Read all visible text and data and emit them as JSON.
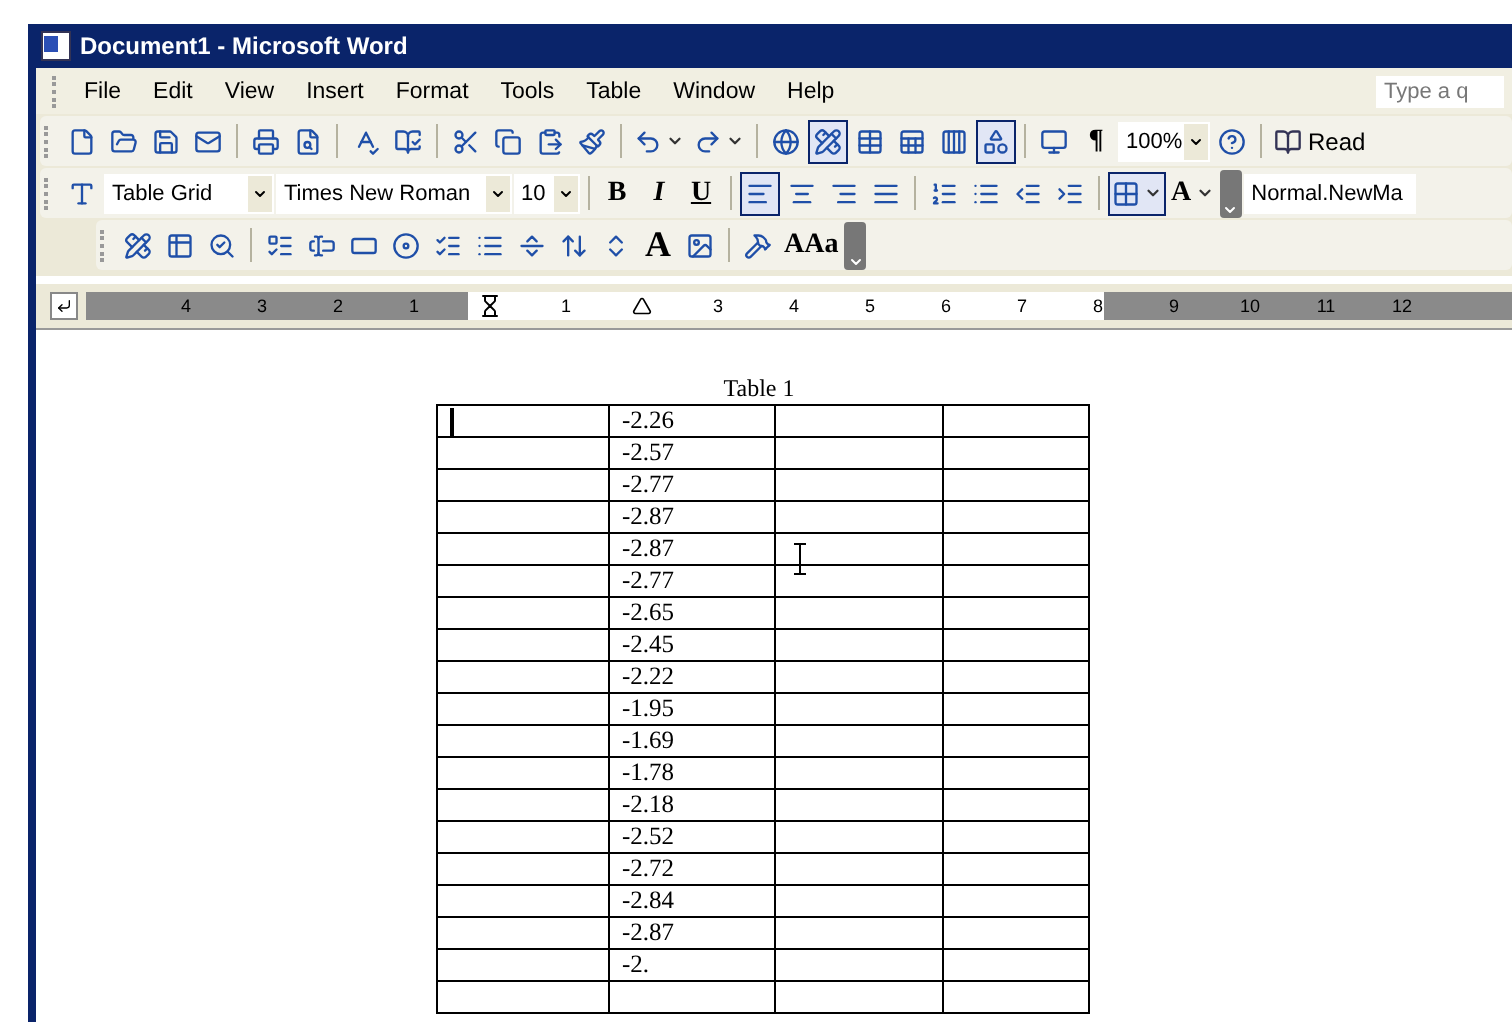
{
  "window": {
    "title": "Document1 - Microsoft Word"
  },
  "menu": [
    {
      "label": "File"
    },
    {
      "label": "Edit"
    },
    {
      "label": "View"
    },
    {
      "label": "Insert"
    },
    {
      "label": "Format"
    },
    {
      "label": "Tools"
    },
    {
      "label": "Table"
    },
    {
      "label": "Window"
    },
    {
      "label": "Help"
    }
  ],
  "help_search": {
    "placeholder": "Type a q"
  },
  "toolbars": [
    [
      {
        "kind": "icon",
        "pressed": false
      },
      {
        "kind": "icon",
        "pressed": false
      },
      {
        "kind": "icon",
        "pressed": false
      },
      {
        "kind": "icon",
        "pressed": false
      },
      {
        "kind": "separator"
      },
      {
        "kind": "icon",
        "pressed": false
      },
      {
        "kind": "icon",
        "pressed": false
      },
      {
        "kind": "separator"
      },
      {
        "kind": "icon",
        "pressed": false
      },
      {
        "kind": "icon",
        "pressed": false
      },
      {
        "kind": "separator"
      },
      {
        "kind": "icon",
        "pressed": false
      },
      {
        "kind": "icon",
        "pressed": false
      },
      {
        "kind": "icon",
        "pressed": false
      },
      {
        "kind": "icon",
        "pressed": false
      },
      {
        "kind": "separator"
      },
      {
        "kind": "icon-caret",
        "pressed": false
      },
      {
        "kind": "icon-caret",
        "pressed": false
      },
      {
        "kind": "separator"
      },
      {
        "kind": "icon",
        "pressed": false
      },
      {
        "kind": "icon",
        "pressed": true
      },
      {
        "kind": "icon",
        "pressed": false
      },
      {
        "kind": "icon",
        "pressed": false
      },
      {
        "kind": "icon",
        "pressed": false
      },
      {
        "kind": "icon",
        "pressed": true
      },
      {
        "kind": "separator"
      },
      {
        "kind": "icon",
        "pressed": false
      },
      {
        "kind": "text",
        "label": "¶",
        "pressed": false
      },
      {
        "kind": "dropdown",
        "value": "100%"
      },
      {
        "kind": "icon",
        "pressed": false
      },
      {
        "kind": "separator"
      },
      {
        "kind": "icon-text",
        "label": "Read"
      }
    ],
    [
      {
        "kind": "icon",
        "pressed": false
      },
      {
        "kind": "dropdown",
        "value": "Table Grid"
      },
      {
        "kind": "dropdown",
        "value": "Times New Roman"
      },
      {
        "kind": "dropdown",
        "value": "10"
      },
      {
        "kind": "separator"
      },
      {
        "kind": "text",
        "label": "B",
        "pressed": false
      },
      {
        "kind": "text",
        "label": "I",
        "pressed": false
      },
      {
        "kind": "text",
        "label": "U",
        "pressed": false
      },
      {
        "kind": "separator"
      },
      {
        "kind": "icon",
        "pressed": true
      },
      {
        "kind": "icon",
        "pressed": false
      },
      {
        "kind": "icon",
        "pressed": false
      },
      {
        "kind": "icon",
        "pressed": false
      },
      {
        "kind": "separator"
      },
      {
        "kind": "icon",
        "pressed": false
      },
      {
        "kind": "icon",
        "pressed": false
      },
      {
        "kind": "icon",
        "pressed": false
      },
      {
        "kind": "icon",
        "pressed": false
      },
      {
        "kind": "separator"
      },
      {
        "kind": "icon-caret",
        "pressed": true
      },
      {
        "kind": "text-caret",
        "label": "A",
        "pressed": false
      },
      {
        "kind": "chevron"
      },
      {
        "kind": "dropdown",
        "value": "Normal.NewMa"
      }
    ],
    [
      {
        "kind": "icon",
        "pressed": false
      },
      {
        "kind": "icon",
        "pressed": false
      },
      {
        "kind": "icon",
        "pressed": false
      },
      {
        "kind": "separator"
      },
      {
        "kind": "icon",
        "pressed": false
      },
      {
        "kind": "icon",
        "pressed": false
      },
      {
        "kind": "icon",
        "pressed": false
      },
      {
        "kind": "icon",
        "pressed": false
      },
      {
        "kind": "icon",
        "pressed": false
      },
      {
        "kind": "icon",
        "pressed": false
      },
      {
        "kind": "icon",
        "pressed": false
      },
      {
        "kind": "icon",
        "pressed": false
      },
      {
        "kind": "icon",
        "pressed": false
      },
      {
        "kind": "text",
        "label": "A",
        "pressed": false
      },
      {
        "kind": "icon",
        "pressed": false
      },
      {
        "kind": "separator"
      },
      {
        "kind": "icon",
        "pressed": false
      },
      {
        "kind": "text",
        "label": "AAa",
        "pressed": false
      },
      {
        "kind": "chevron"
      }
    ]
  ],
  "ruler": {
    "marks": [
      {
        "kind": "number",
        "label": "4"
      },
      {
        "kind": "number",
        "label": "3"
      },
      {
        "kind": "number",
        "label": "2"
      },
      {
        "kind": "number",
        "label": "1"
      },
      {
        "kind": "indent"
      },
      {
        "kind": "number",
        "label": "1"
      },
      {
        "kind": "tab"
      },
      {
        "kind": "number",
        "label": "3"
      },
      {
        "kind": "number",
        "label": "4"
      },
      {
        "kind": "number",
        "label": "5"
      },
      {
        "kind": "number",
        "label": "6"
      },
      {
        "kind": "number",
        "label": "7"
      },
      {
        "kind": "number",
        "label": "8"
      },
      {
        "kind": "number",
        "label": "9"
      },
      {
        "kind": "number",
        "label": "10"
      },
      {
        "kind": "number",
        "label": "11"
      },
      {
        "kind": "number",
        "label": "12"
      }
    ]
  },
  "document": {
    "table_caption": "Table 1",
    "table": {
      "rows": [
        {
          "column_2": "-2.26",
          "caret": true
        },
        {
          "column_2": "-2.57"
        },
        {
          "column_2": "-2.77"
        },
        {
          "column_2": "-2.87"
        },
        {
          "column_2": "-2.87"
        },
        {
          "column_2": "-2.77"
        },
        {
          "column_2": "-2.65"
        },
        {
          "column_2": "-2.45"
        },
        {
          "column_2": "-2.22"
        },
        {
          "column_2": "-1.95"
        },
        {
          "column_2": "-1.69"
        },
        {
          "column_2": "-1.78"
        },
        {
          "column_2": "-2.18"
        },
        {
          "column_2": "-2.52"
        },
        {
          "column_2": "-2.72"
        },
        {
          "column_2": "-2.84"
        },
        {
          "column_2": "-2.87"
        },
        {
          "column_2": "-2."
        },
        {}
      ]
    }
  }
}
